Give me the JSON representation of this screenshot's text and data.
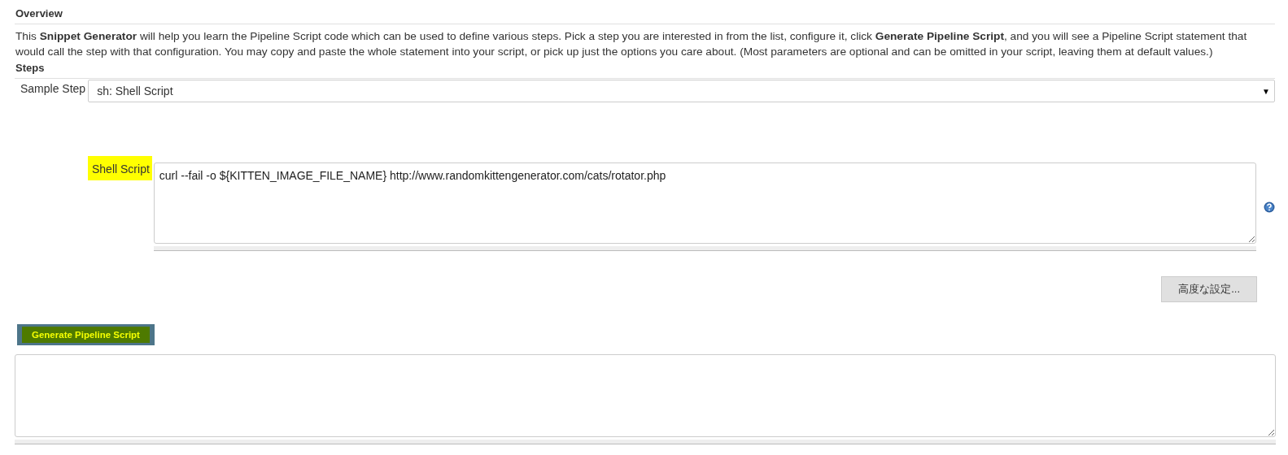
{
  "overview": {
    "title": "Overview",
    "description": "This **Snippet Generator** will help you learn the Pipeline Script code which can be used to define various steps. Pick a step you are interested in from the list, configure it, click **Generate Pipeline Script**, and you will see a Pipeline Script statement that would call the step with that configuration. You may copy and paste the whole statement into your script, or pick up just the options you care about. (Most parameters are optional and can be omitted in your script, leaving them at default values.)"
  },
  "steps": {
    "title": "Steps",
    "sample_step": {
      "label": "Sample Step",
      "value": "sh: Shell Script",
      "arrow": "▼"
    },
    "shell_script": {
      "label": "Shell Script",
      "highlighted": true,
      "value": "curl --fail -o ${KITTEN_IMAGE_FILE_NAME} http://www.randomkittengenerator.com/cats/rotator.php"
    },
    "advanced_button": "高度な設定..."
  },
  "generate_button": {
    "label": "Generate Pipeline Script",
    "highlighted": true
  }
}
